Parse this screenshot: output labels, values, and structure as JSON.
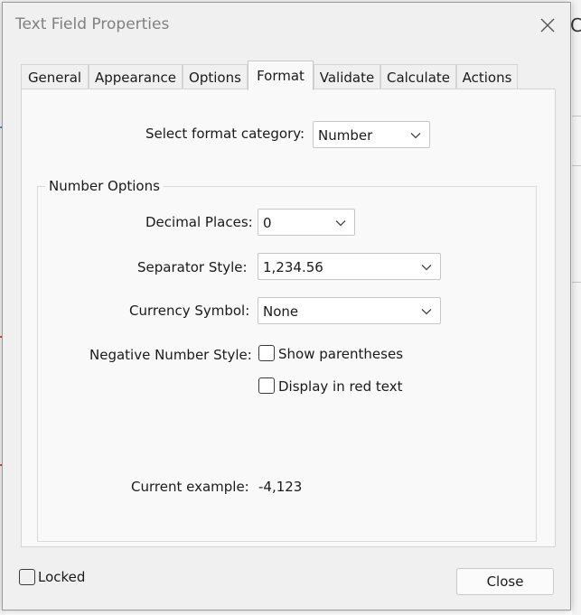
{
  "window": {
    "title": "Text Field Properties",
    "close_icon": "close-icon"
  },
  "background": {
    "partial_text": "Co"
  },
  "tabs": [
    {
      "label": "General"
    },
    {
      "label": "Appearance"
    },
    {
      "label": "Options"
    },
    {
      "label": "Format",
      "active": true
    },
    {
      "label": "Validate"
    },
    {
      "label": "Calculate"
    },
    {
      "label": "Actions"
    }
  ],
  "format": {
    "category_label": "Select format category:",
    "category_value": "Number",
    "group_title": "Number Options",
    "decimal_places_label": "Decimal Places:",
    "decimal_places_value": "0",
    "separator_label": "Separator Style:",
    "separator_value": "1,234.56",
    "currency_label": "Currency Symbol:",
    "currency_value": "None",
    "negative_label": "Negative Number Style:",
    "show_parentheses_label": "Show parentheses",
    "show_parentheses_checked": false,
    "red_text_label": "Display in red text",
    "red_text_checked": false,
    "example_label": "Current example:",
    "example_value": "-4,123"
  },
  "footer": {
    "locked_label": "Locked",
    "locked_checked": false,
    "close_label": "Close"
  },
  "colors": {
    "dialog_bg": "#f0f0f0",
    "panel_bg": "#f9f9f9",
    "title_text": "#808080"
  }
}
